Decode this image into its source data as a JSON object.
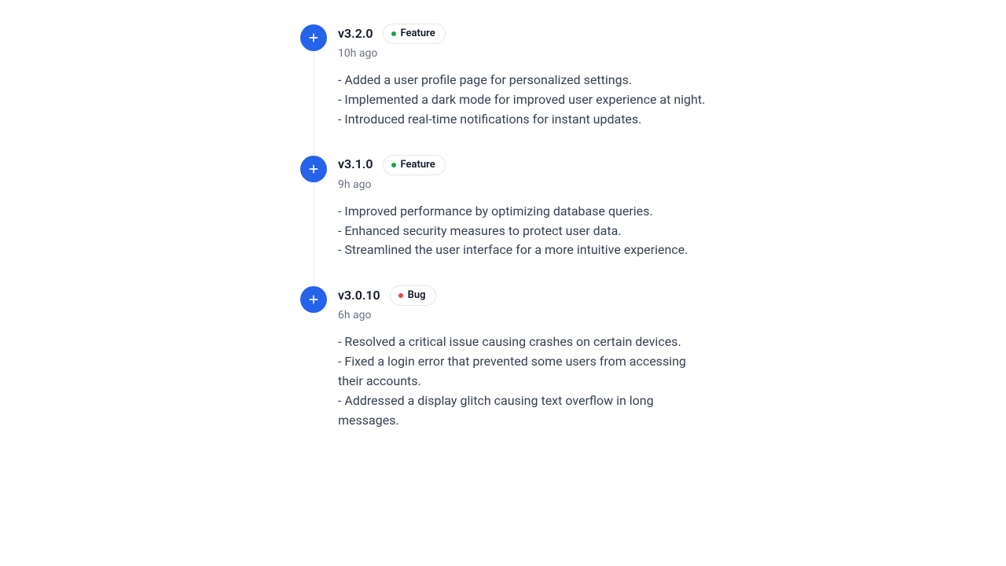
{
  "releases": [
    {
      "version": "v3.2.0",
      "badge": {
        "label": "Feature",
        "kind": "feature"
      },
      "time": "10h ago",
      "notes": [
        "- Added a user profile page for personalized settings.",
        "- Implemented a dark mode for improved user experience at night.",
        "- Introduced real-time notifications for instant updates."
      ]
    },
    {
      "version": "v3.1.0",
      "badge": {
        "label": "Feature",
        "kind": "feature"
      },
      "time": "9h ago",
      "notes": [
        "- Improved performance by optimizing database queries.",
        "- Enhanced security measures to protect user data.",
        "- Streamlined the user interface for a more intuitive experience."
      ]
    },
    {
      "version": "v3.0.10",
      "badge": {
        "label": "Bug",
        "kind": "bug"
      },
      "time": "6h ago",
      "notes": [
        "- Resolved a critical issue causing crashes on certain devices.",
        "- Fixed a login error that prevented some users from accessing their accounts.",
        "- Addressed a display glitch causing text overflow in long messages."
      ]
    }
  ]
}
